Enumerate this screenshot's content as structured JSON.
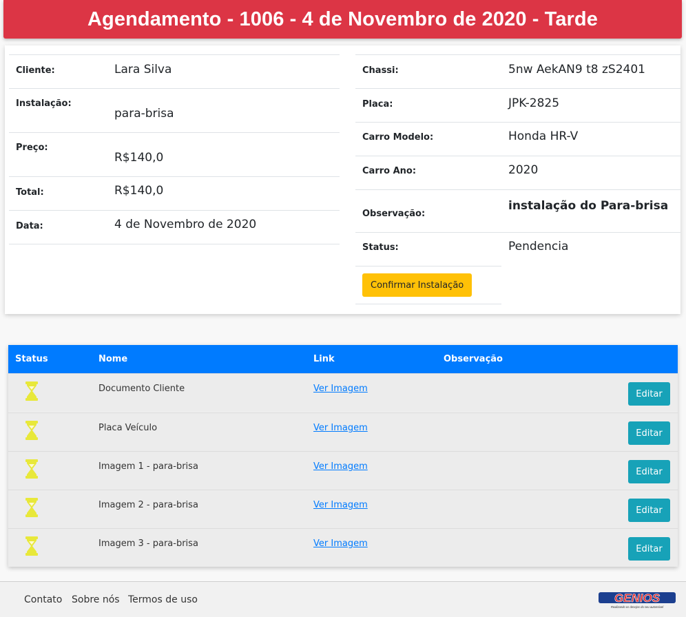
{
  "header": {
    "title": "Agendamento - 1006 - 4 de Novembro de 2020 - Tarde"
  },
  "details_left": [
    {
      "label": "Cliente:",
      "value": "Lara Silva"
    },
    {
      "label": "Instalação:",
      "value": "para-brisa"
    },
    {
      "label": "Preço:",
      "value": "R$140,0"
    },
    {
      "label": "Total:",
      "value": "R$140,0"
    },
    {
      "label": "Data:",
      "value": "4 de Novembro de 2020"
    }
  ],
  "details_right": [
    {
      "label": "Chassi:",
      "value": "5nw AekAN9 t8 zS2401"
    },
    {
      "label": "Placa:",
      "value": "JPK-2825"
    },
    {
      "label": "Carro Modelo:",
      "value": "Honda HR-V"
    },
    {
      "label": "Carro Ano:",
      "value": "2020"
    },
    {
      "label": "Observação:",
      "value": "instalação do Para-brisa"
    },
    {
      "label": "Status:",
      "value": "Pendencia"
    }
  ],
  "confirm_button": "Confirmar Instalação",
  "table": {
    "headers": {
      "status": "Status",
      "nome": "Nome",
      "link": "Link",
      "observacao": "Observação"
    },
    "rows": [
      {
        "status_icon": "hourglass-icon",
        "nome": "Documento Cliente",
        "link": "Ver Imagem",
        "observacao": "",
        "action": "Editar"
      },
      {
        "status_icon": "hourglass-icon",
        "nome": "Placa Veículo",
        "link": "Ver Imagem",
        "observacao": "",
        "action": "Editar"
      },
      {
        "status_icon": "hourglass-icon",
        "nome": "Imagem 1 - para-brisa",
        "link": "Ver Imagem",
        "observacao": "",
        "action": "Editar"
      },
      {
        "status_icon": "hourglass-icon",
        "nome": "Imagem 2 - para-brisa",
        "link": "Ver Imagem",
        "observacao": "",
        "action": "Editar"
      },
      {
        "status_icon": "hourglass-icon",
        "nome": "Imagem 3 - para-brisa",
        "link": "Ver Imagem",
        "observacao": "",
        "action": "Editar"
      }
    ]
  },
  "footer": {
    "links": [
      "Contato",
      "Sobre nós",
      "Termos de uso"
    ],
    "logo_text": "GENIOS",
    "logo_tagline": "Realizando os desejos do seu automóvel"
  },
  "colors": {
    "header_bg": "#dc3545",
    "confirm_button": "#ffc107",
    "table_header": "#007bff",
    "edit_button": "#17a2b8",
    "status_icon": "#e8e83a"
  }
}
